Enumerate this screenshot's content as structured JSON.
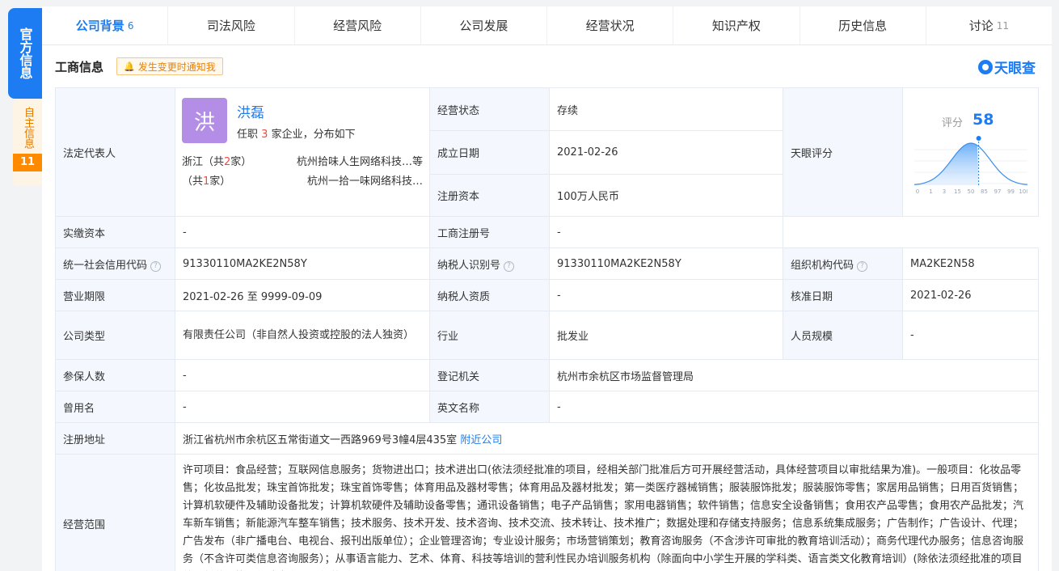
{
  "side": {
    "official": "官方信息",
    "self": "自主信息",
    "self_count": "11"
  },
  "tabs": [
    {
      "label": "公司背景",
      "count": "6"
    },
    {
      "label": "司法风险",
      "count": ""
    },
    {
      "label": "经营风险",
      "count": ""
    },
    {
      "label": "公司发展",
      "count": ""
    },
    {
      "label": "经营状况",
      "count": ""
    },
    {
      "label": "知识产权",
      "count": ""
    },
    {
      "label": "历史信息",
      "count": ""
    },
    {
      "label": "讨论",
      "count": "11"
    }
  ],
  "section": {
    "title": "工商信息",
    "notify": "发生变更时通知我",
    "logo": "天眼查"
  },
  "legal_rep": {
    "label": "法定代表人",
    "avatar_char": "洪",
    "name": "洪磊",
    "jobs_prefix": "任职",
    "jobs_count": "3",
    "jobs_suffix": "家企业，分布如下",
    "row1_region": "浙江（共",
    "row1_count": "2",
    "row1_unit": "家）",
    "row1_company": "杭州拾味人生网络科技…等",
    "row2_region": "（共",
    "row2_count": "1",
    "row2_unit": "家）",
    "row2_company": "杭州一拾一味网络科技…"
  },
  "score": {
    "label": "天眼评分",
    "caption": "评分",
    "value": "58",
    "axis": [
      "0",
      "1",
      "3",
      "15",
      "50",
      "85",
      "97",
      "99",
      "100"
    ],
    "fraction": 0.58
  },
  "fields": {
    "status_label": "经营状态",
    "status": "存续",
    "found_label": "成立日期",
    "found": "2021-02-26",
    "capital_label": "注册资本",
    "capital": "100万人民币",
    "paid_label": "实缴资本",
    "paid": "-",
    "regno_label": "工商注册号",
    "regno": "-",
    "credit_label": "统一社会信用代码",
    "credit": "91330110MA2KE2N58Y",
    "taxid_label": "纳税人识别号",
    "taxid": "91330110MA2KE2N58Y",
    "org_label": "组织机构代码",
    "org": "MA2KE2N58",
    "term_label": "营业期限",
    "term_from": "2021-02-26",
    "term_sep": "至",
    "term_to": "9999-09-09",
    "taxq_label": "纳税人资质",
    "taxq": "-",
    "approve_label": "核准日期",
    "approve": "2021-02-26",
    "type_label": "公司类型",
    "type": "有限责任公司（非自然人投资或控股的法人独资）",
    "industry_label": "行业",
    "industry": "批发业",
    "staff_label": "人员规模",
    "staff": "-",
    "insured_label": "参保人数",
    "insured": "-",
    "authority_label": "登记机关",
    "authority": "杭州市余杭区市场监督管理局",
    "former_label": "曾用名",
    "former": "-",
    "en_label": "英文名称",
    "en": "-",
    "addr_label": "注册地址",
    "addr": "浙江省杭州市余杭区五常街道文一西路969号3幢4层435室",
    "addr_link": "附近公司",
    "scope_label": "经营范围",
    "scope": "许可项目：食品经营；互联网信息服务；货物进出口；技术进出口(依法须经批准的项目，经相关部门批准后方可开展经营活动，具体经营项目以审批结果为准)。一般项目：化妆品零售；化妆品批发；珠宝首饰批发；珠宝首饰零售；体育用品及器材零售；体育用品及器材批发；第一类医疗器械销售；服装服饰批发；服装服饰零售；家居用品销售；日用百货销售；计算机软硬件及辅助设备批发；计算机软硬件及辅助设备零售；通讯设备销售；电子产品销售；家用电器销售；软件销售；信息安全设备销售；食用农产品零售；食用农产品批发；汽车新车销售；新能源汽车整车销售；技术服务、技术开发、技术咨询、技术交流、技术转让、技术推广；数据处理和存储支持服务；信息系统集成服务；广告制作；广告设计、代理；广告发布（非广播电台、电视台、报刊出版单位）；企业管理咨询；专业设计服务；市场营销策划；教育咨询服务（不含涉许可审批的教育培训活动）；商务代理代办服务；信息咨询服务（不含许可类信息咨询服务）；从事语言能力、艺术、体育、科技等培训的营利性民办培训服务机构（除面向中小学生开展的学科类、语言类文化教育培训）(除依法须经批准的项目外，凭营业执照依法自主开展经营活动)。"
  }
}
